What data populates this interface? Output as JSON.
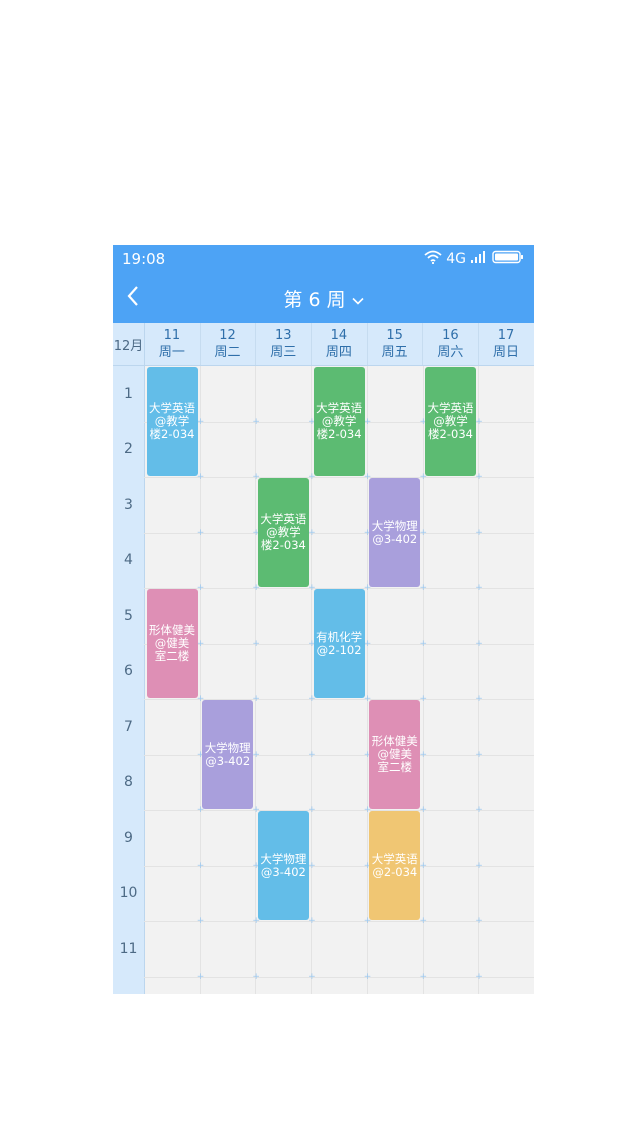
{
  "status": {
    "time": "19:08",
    "network": "4G"
  },
  "nav": {
    "title": "第 6 周"
  },
  "header": {
    "month": "12月",
    "days": [
      {
        "date": "11",
        "weekday": "周一"
      },
      {
        "date": "12",
        "weekday": "周二"
      },
      {
        "date": "13",
        "weekday": "周三"
      },
      {
        "date": "14",
        "weekday": "周四"
      },
      {
        "date": "15",
        "weekday": "周五"
      },
      {
        "date": "16",
        "weekday": "周六"
      },
      {
        "date": "17",
        "weekday": "周日"
      }
    ]
  },
  "periods": [
    "1",
    "2",
    "3",
    "4",
    "5",
    "6",
    "7",
    "8",
    "9",
    "10",
    "11"
  ],
  "courses": [
    {
      "day": 0,
      "start": 1,
      "length": 2,
      "name": "大学英语",
      "location": "@教学楼2-034",
      "color": "#63bde8"
    },
    {
      "day": 3,
      "start": 1,
      "length": 2,
      "name": "大学英语",
      "location": "@教学楼2-034",
      "color": "#5cbb72"
    },
    {
      "day": 5,
      "start": 1,
      "length": 2,
      "name": "大学英语",
      "location": "@教学楼2-034",
      "color": "#5cbb72"
    },
    {
      "day": 2,
      "start": 3,
      "length": 2,
      "name": "大学英语",
      "location": "@教学楼2-034",
      "color": "#5cbb72"
    },
    {
      "day": 4,
      "start": 3,
      "length": 2,
      "name": "大学物理",
      "location": "@3-402",
      "color": "#a99fdc"
    },
    {
      "day": 0,
      "start": 5,
      "length": 2,
      "name": "形体健美",
      "location": "@健美室二楼",
      "color": "#de8fb5"
    },
    {
      "day": 3,
      "start": 5,
      "length": 2,
      "name": "有机化学",
      "location": "@2-102",
      "color": "#63bde8"
    },
    {
      "day": 1,
      "start": 7,
      "length": 2,
      "name": "大学物理",
      "location": "@3-402",
      "color": "#a99fdc"
    },
    {
      "day": 4,
      "start": 7,
      "length": 2,
      "name": "形体健美",
      "location": "@健美室二楼",
      "color": "#de8fb5"
    },
    {
      "day": 2,
      "start": 9,
      "length": 2,
      "name": "大学物理",
      "location": "@3-402",
      "color": "#63bde8"
    },
    {
      "day": 4,
      "start": 9,
      "length": 2,
      "name": "大学英语",
      "location": "@2-034",
      "color": "#f0c673"
    }
  ]
}
